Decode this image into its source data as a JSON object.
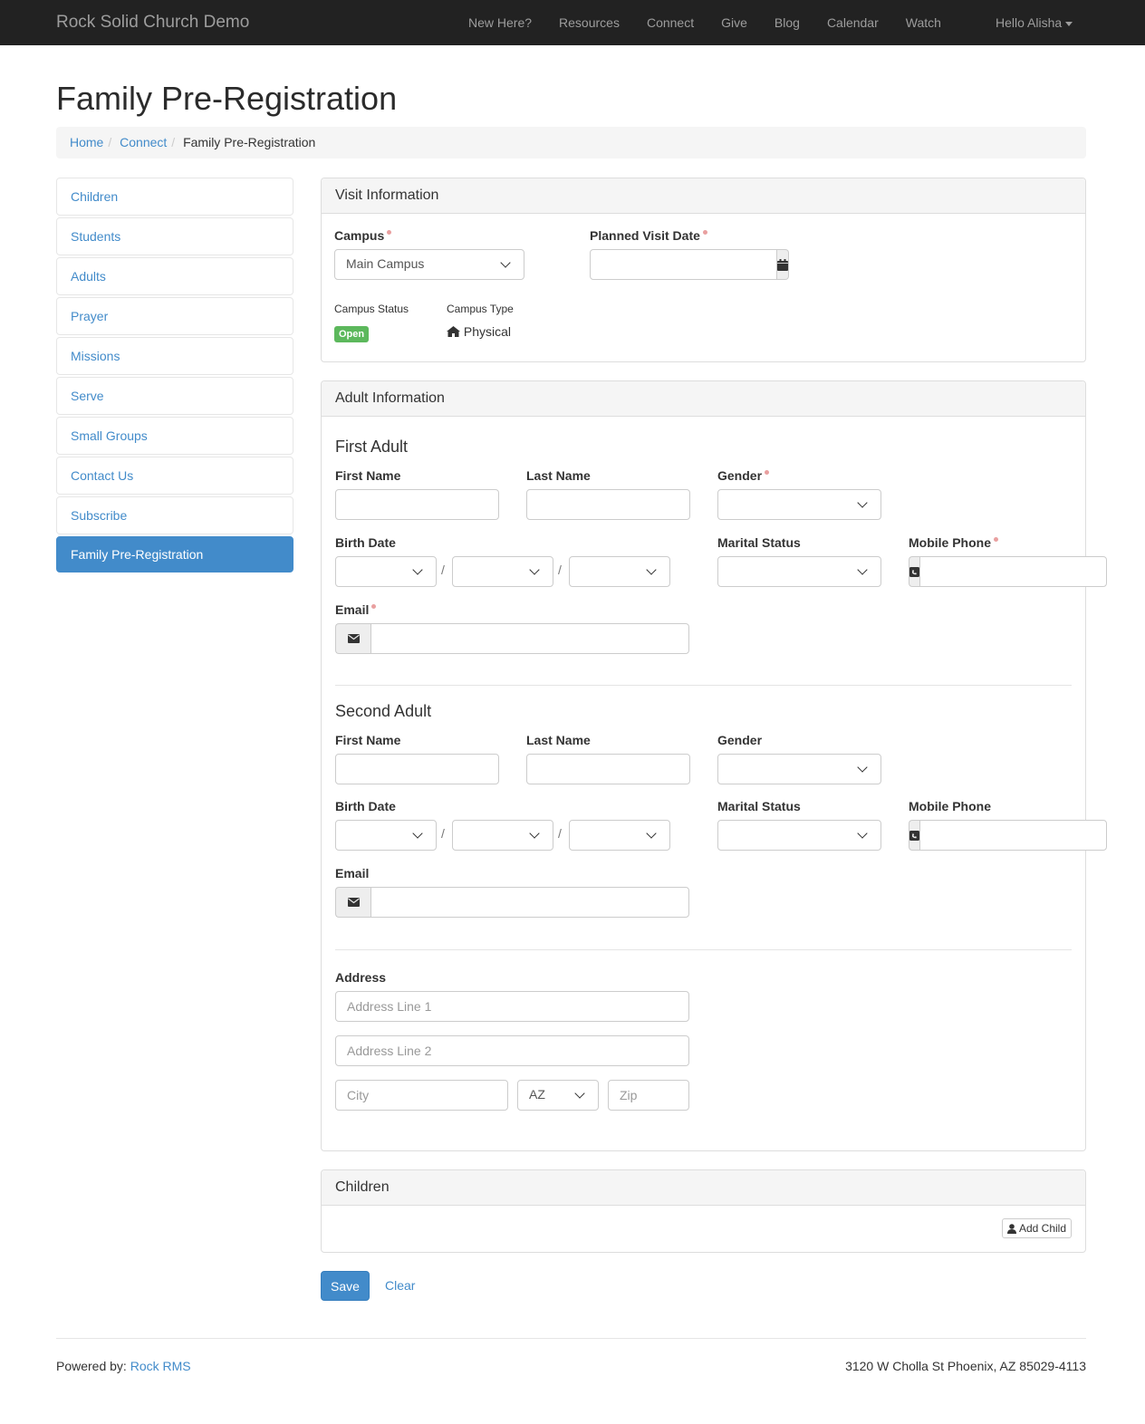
{
  "navbar": {
    "brand": "Rock Solid Church Demo",
    "links": [
      "New Here?",
      "Resources",
      "Connect",
      "Give",
      "Blog",
      "Calendar",
      "Watch"
    ],
    "user_greeting": "Hello Alisha"
  },
  "page": {
    "title": "Family Pre-Registration",
    "breadcrumb": [
      "Home",
      "Connect",
      "Family Pre-Registration"
    ]
  },
  "sidebar": {
    "items": [
      "Children",
      "Students",
      "Adults",
      "Prayer",
      "Missions",
      "Serve",
      "Small Groups",
      "Contact Us",
      "Subscribe",
      "Family Pre-Registration"
    ],
    "active": "Family Pre-Registration"
  },
  "visit": {
    "heading": "Visit Information",
    "campus_label": "Campus",
    "campus_value": "Main Campus",
    "planned_date_label": "Planned Visit Date",
    "planned_date_value": "",
    "campus_status_label": "Campus Status",
    "campus_status_value": "Open",
    "campus_type_label": "Campus Type",
    "campus_type_value": "Physical"
  },
  "adults": {
    "heading": "Adult Information",
    "first": {
      "title": "First Adult",
      "first_name": "First Name",
      "last_name": "Last Name",
      "gender": "Gender",
      "birth_date": "Birth Date",
      "marital_status": "Marital Status",
      "mobile_phone": "Mobile Phone",
      "email": "Email"
    },
    "second": {
      "title": "Second Adult",
      "first_name": "First Name",
      "last_name": "Last Name",
      "gender": "Gender",
      "birth_date": "Birth Date",
      "marital_status": "Marital Status",
      "mobile_phone": "Mobile Phone",
      "email": "Email"
    },
    "address": {
      "label": "Address",
      "line1_placeholder": "Address Line 1",
      "line2_placeholder": "Address Line 2",
      "city_placeholder": "City",
      "state_value": "AZ",
      "zip_placeholder": "Zip"
    }
  },
  "children": {
    "heading": "Children",
    "add_child_label": "Add Child"
  },
  "actions": {
    "save": "Save",
    "clear": "Clear"
  },
  "footer": {
    "powered_by": "Powered by:",
    "powered_link": "Rock RMS",
    "address": "3120 W Cholla St Phoenix, AZ 85029-4113"
  },
  "colors": {
    "primary": "#428bca",
    "navbar_bg": "#222222",
    "success": "#5cb85c",
    "required_dot": "#e9a0a0"
  }
}
